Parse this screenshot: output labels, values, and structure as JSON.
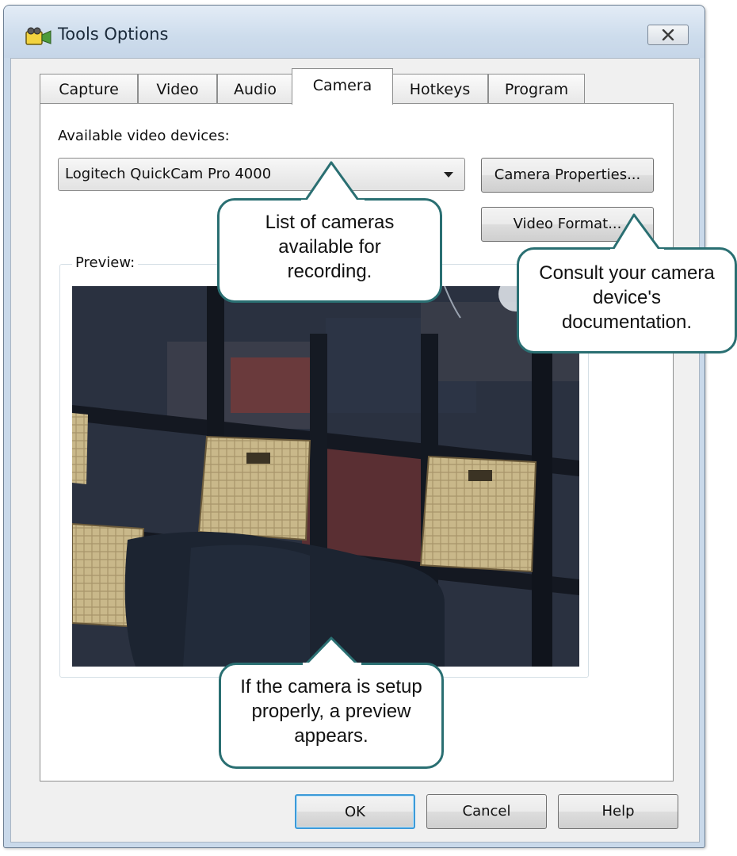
{
  "window": {
    "title": "Tools Options"
  },
  "tabs": [
    {
      "label": "Capture"
    },
    {
      "label": "Video"
    },
    {
      "label": "Audio"
    },
    {
      "label": "Camera"
    },
    {
      "label": "Hotkeys"
    },
    {
      "label": "Program"
    }
  ],
  "active_tab": "Camera",
  "camera": {
    "devices_label": "Available video devices:",
    "selected_device": "Logitech QuickCam Pro 4000",
    "camera_properties_label": "Camera Properties...",
    "video_format_label": "Video Format...",
    "preview_label": "Preview:"
  },
  "callouts": {
    "list": "List of cameras available for recording.",
    "consult": "Consult your camera device's documentation.",
    "preview": "If the camera is setup properly, a preview appears."
  },
  "footer": {
    "ok_label": "OK",
    "cancel_label": "Cancel",
    "help_label": "Help"
  },
  "colors": {
    "callout_border": "#2a6f72",
    "window_frame": "#c9d9ea",
    "ok_focus": "#3c9ad8"
  },
  "icons": {
    "app": "camcorder-icon",
    "close": "close-icon",
    "dropdown": "chevron-down-icon"
  }
}
